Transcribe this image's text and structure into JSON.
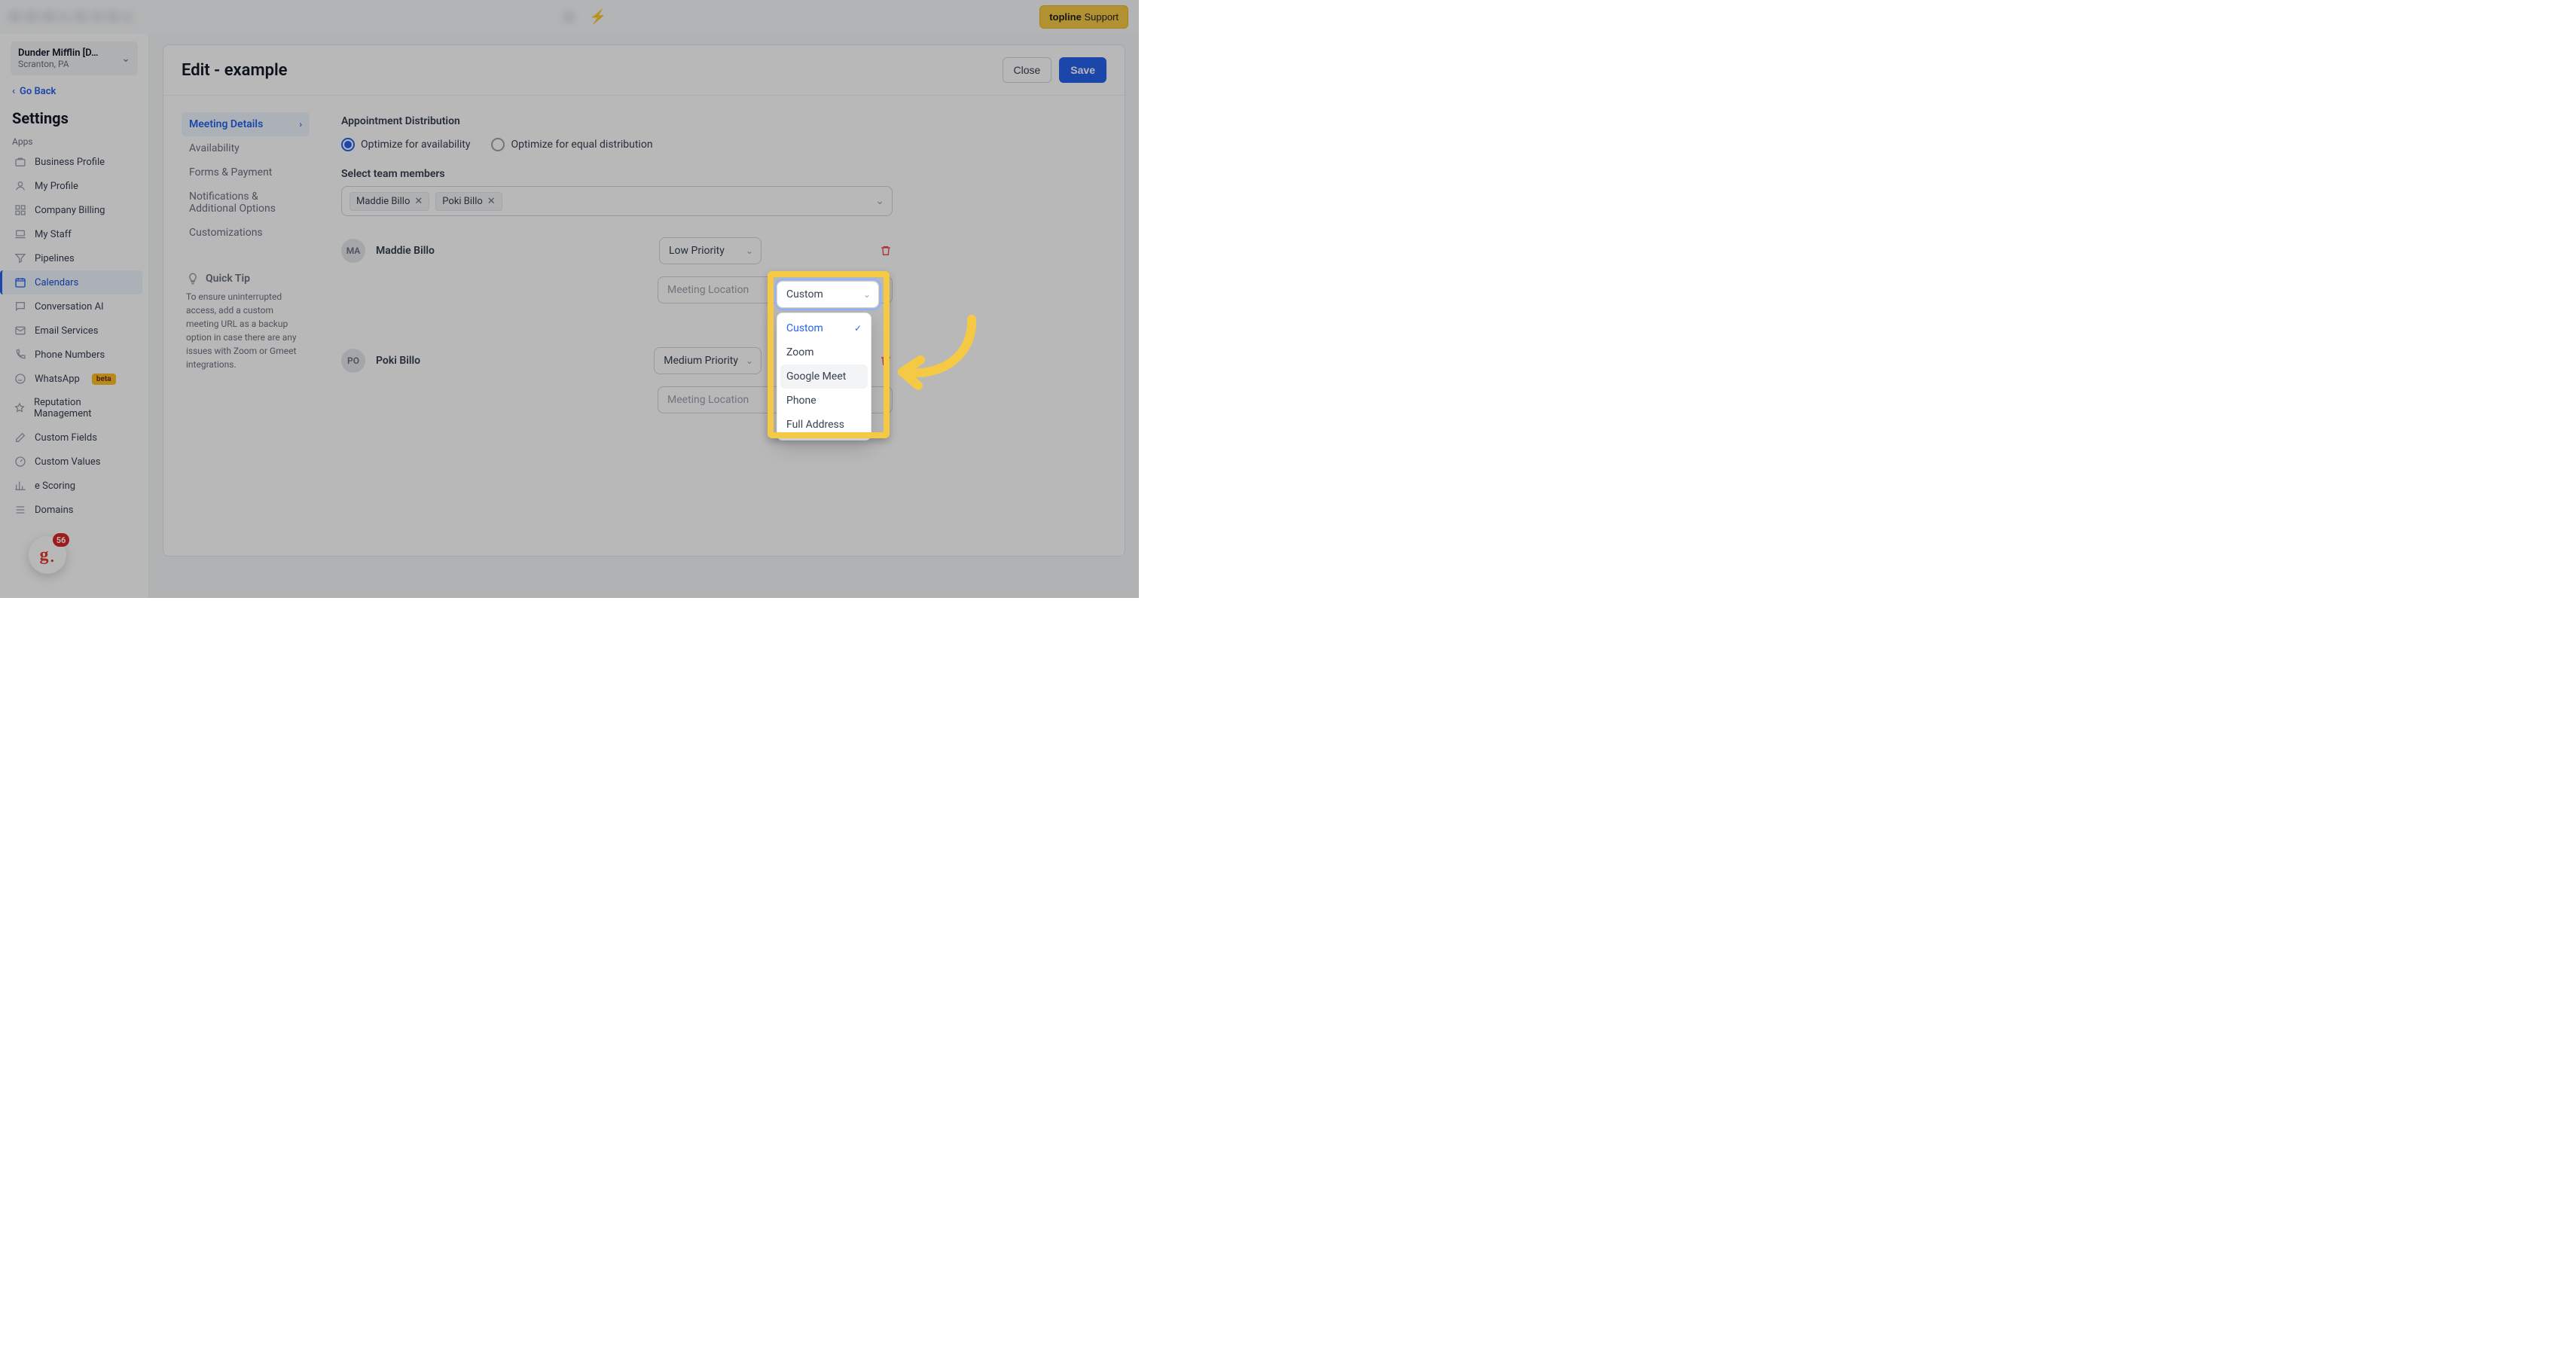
{
  "topbar": {
    "blur_left": "H • G • H • L • E • V • E • L",
    "blur_right": "A",
    "support_label": "topline",
    "support_suffix": "Support"
  },
  "sidebar": {
    "org_name": "Dunder Mifflin [D…",
    "org_sub": "Scranton, PA",
    "go_back": "Go Back",
    "heading": "Settings",
    "group_label": "Apps",
    "items": [
      {
        "icon": "briefcase",
        "label": "Business Profile"
      },
      {
        "icon": "user",
        "label": "My Profile"
      },
      {
        "icon": "grid",
        "label": "Company Billing"
      },
      {
        "icon": "laptop",
        "label": "My Staff"
      },
      {
        "icon": "funnel",
        "label": "Pipelines"
      },
      {
        "icon": "calendar",
        "label": "Calendars",
        "active": true
      },
      {
        "icon": "chat",
        "label": "Conversation AI"
      },
      {
        "icon": "mail",
        "label": "Email Services"
      },
      {
        "icon": "phone",
        "label": "Phone Numbers"
      },
      {
        "icon": "whatsapp",
        "label": "WhatsApp",
        "beta": "beta"
      },
      {
        "icon": "star",
        "label": "Reputation Management"
      },
      {
        "icon": "edit",
        "label": "Custom Fields"
      },
      {
        "icon": "gauge",
        "label": "Custom Values"
      },
      {
        "icon": "chart",
        "label": "e Scoring"
      },
      {
        "icon": "list",
        "label": "Domains"
      }
    ],
    "float_count": "56"
  },
  "panel": {
    "title": "Edit - example",
    "close": "Close",
    "save": "Save",
    "nav": [
      {
        "label": "Meeting Details",
        "active": true
      },
      {
        "label": "Availability"
      },
      {
        "label": "Forms & Payment"
      },
      {
        "label": "Notifications & Additional Options"
      },
      {
        "label": "Customizations"
      }
    ],
    "tip_title": "Quick Tip",
    "tip_text": "To ensure uninterrupted access, add a custom meeting URL as a backup option in case there are any issues with Zoom or Gmeet integrations."
  },
  "form": {
    "section_label": "Appointment Distribution",
    "radio_avail": "Optimize for availability",
    "radio_equal": "Optimize for equal distribution",
    "members_label": "Select team members",
    "tags": [
      "Maddie Billo",
      "Poki Billo"
    ],
    "maddie": {
      "avatar": "MA",
      "name": "Maddie Billo",
      "priority": "Low Priority",
      "type_value": "Custom",
      "loc_placeholder": "Meeting Location"
    },
    "poki": {
      "avatar": "PO",
      "name": "Poki Billo",
      "priority": "Medium Priority",
      "loc_placeholder": "Meeting Location"
    }
  },
  "dropdown": {
    "options": [
      {
        "label": "Custom",
        "selected": true
      },
      {
        "label": "Zoom"
      },
      {
        "label": "Google Meet",
        "hover": true
      },
      {
        "label": "Phone"
      },
      {
        "label": "Full Address"
      }
    ]
  }
}
